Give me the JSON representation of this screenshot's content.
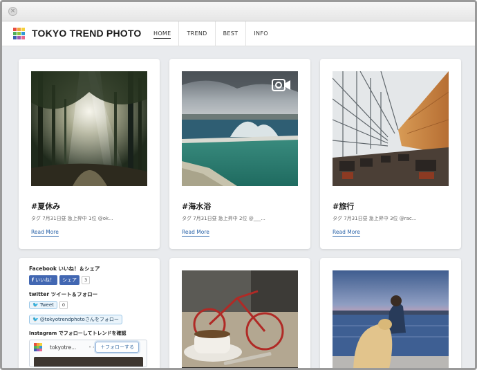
{
  "window": {
    "close_glyph": "×"
  },
  "site": {
    "brand": "TOKYO TREND PHOTO",
    "logo_colors": [
      "#e94d3f",
      "#f2a33a",
      "#f6d13b",
      "#4fb05b",
      "#8dc63f",
      "#2f9ad6",
      "#3b5fb0",
      "#9b59b6",
      "#e9688c"
    ]
  },
  "nav": {
    "items": [
      {
        "label": "HOME",
        "active": true
      },
      {
        "label": "TREND",
        "active": false
      },
      {
        "label": "BEST",
        "active": false
      },
      {
        "label": "INFO",
        "active": false
      }
    ]
  },
  "cards": [
    {
      "tag": "#夏休み",
      "meta": "タグ 7月31日昼 急上昇中 1位 @ok...",
      "read_more": "Read More",
      "photo": "forest-sunbeams-photo"
    },
    {
      "tag": "#海水浴",
      "meta": "タグ 7月31日昼 急上昇中 2位 @___...",
      "read_more": "Read More",
      "photo": "ocean-pool-photo",
      "video_icon": "video-camera-icon"
    },
    {
      "tag": "#旅行",
      "meta": "タグ 7月31日昼 急上昇中 3位 @rac...",
      "read_more": "Read More",
      "photo": "airport-terminal-photo"
    }
  ],
  "social": {
    "facebook_heading": "Facebook いいね！＆シェア",
    "like_label": "いいね！",
    "share_label": "シェア",
    "share_count": "3",
    "twitter_heading": "twitter ツイート＆フォロー",
    "tweet_label": "Tweet",
    "tweet_count": "0",
    "follow_label": "@tokyotrendphotoさんをフォロー",
    "instagram_heading": "Instagram でフォローしてトレンドを確認",
    "ig_user": "tokyotre...",
    "ig_dot": "• 4",
    "ig_follow_label": "＋フォローする"
  },
  "bottom_photos": [
    "cafe-coffee-bicycle-photo",
    "dog-by-the-sea-photo"
  ]
}
